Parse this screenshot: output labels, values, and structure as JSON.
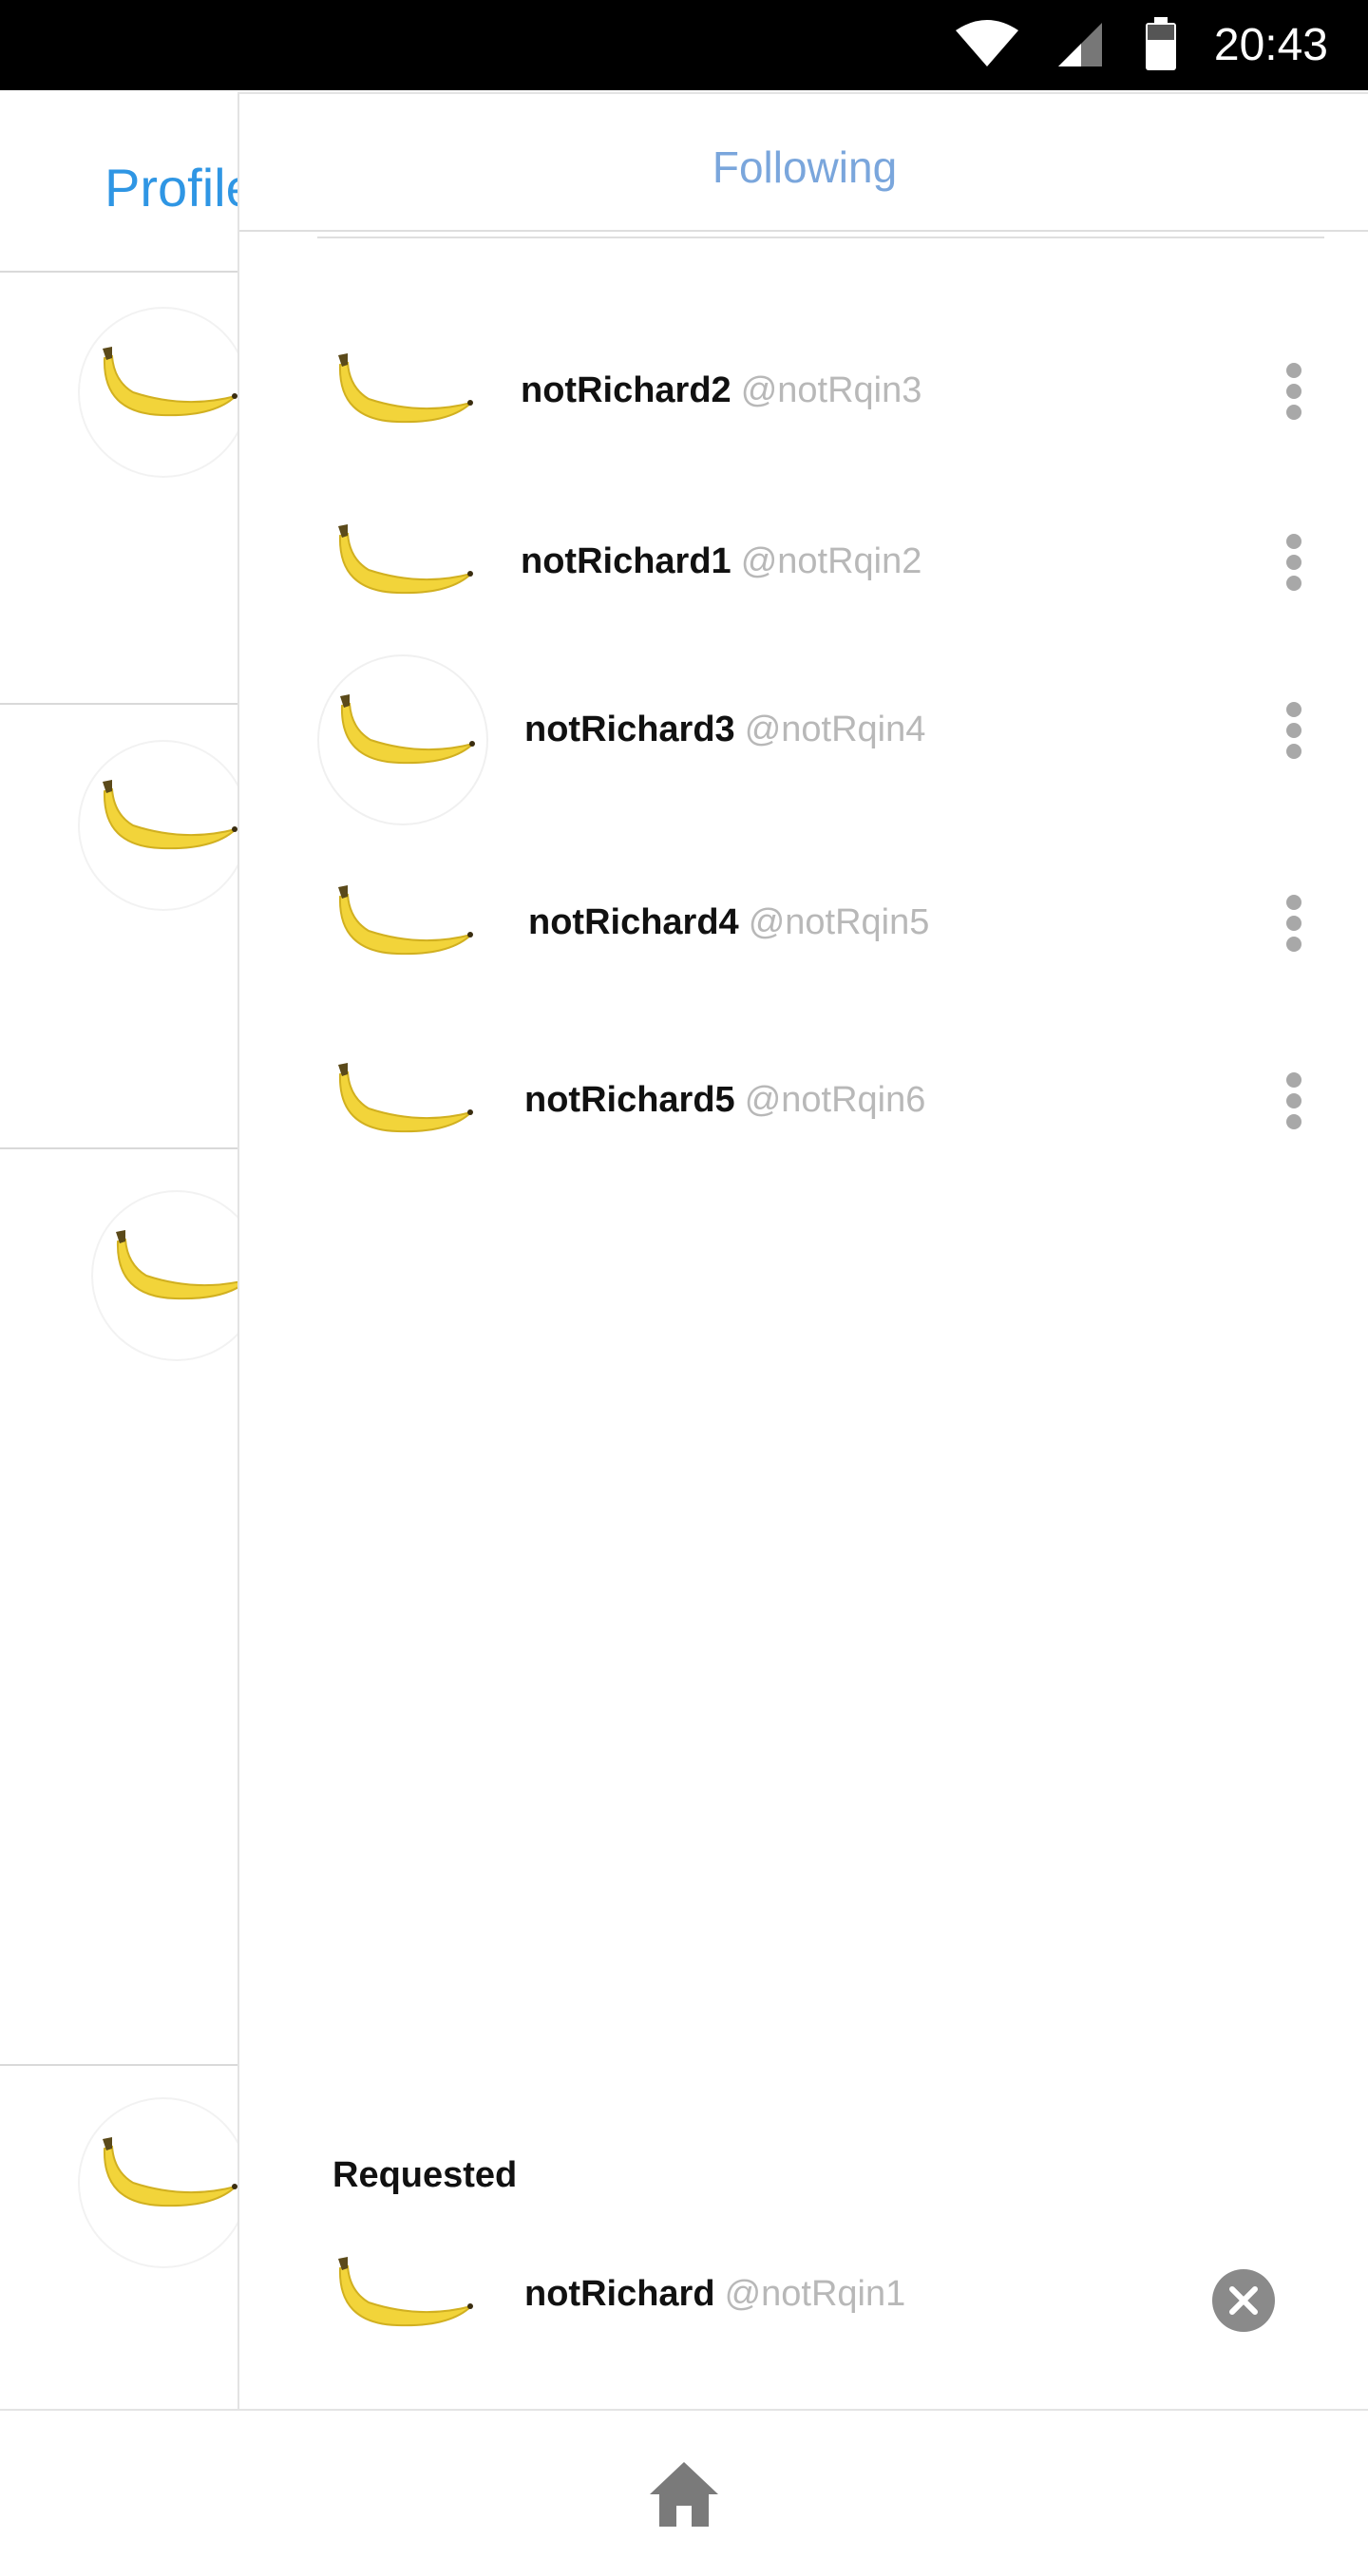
{
  "status_bar": {
    "time": "20:43",
    "icons": [
      "wifi-icon",
      "cell-signal-icon",
      "battery-icon"
    ]
  },
  "background_page": {
    "title": "Profile"
  },
  "drawer": {
    "title": "Following",
    "following": [
      {
        "name": "notRichard2",
        "handle": "@notRqin3"
      },
      {
        "name": "notRichard1",
        "handle": "@notRqin2"
      },
      {
        "name": "notRichard3",
        "handle": "@notRqin4"
      },
      {
        "name": "notRichard4",
        "handle": "@notRqin5"
      },
      {
        "name": "notRichard5",
        "handle": "@notRqin6"
      }
    ],
    "requested_label": "Requested",
    "requested": [
      {
        "name": "notRichard",
        "handle": "@notRqin1"
      }
    ]
  },
  "bottom_nav": {
    "icon": "home-icon"
  },
  "colors": {
    "accent_blue": "#2f96e4",
    "title_blue": "#7aa6dc",
    "handle_gray": "#b8b8b8",
    "banana_yellow": "#f2d43a"
  }
}
